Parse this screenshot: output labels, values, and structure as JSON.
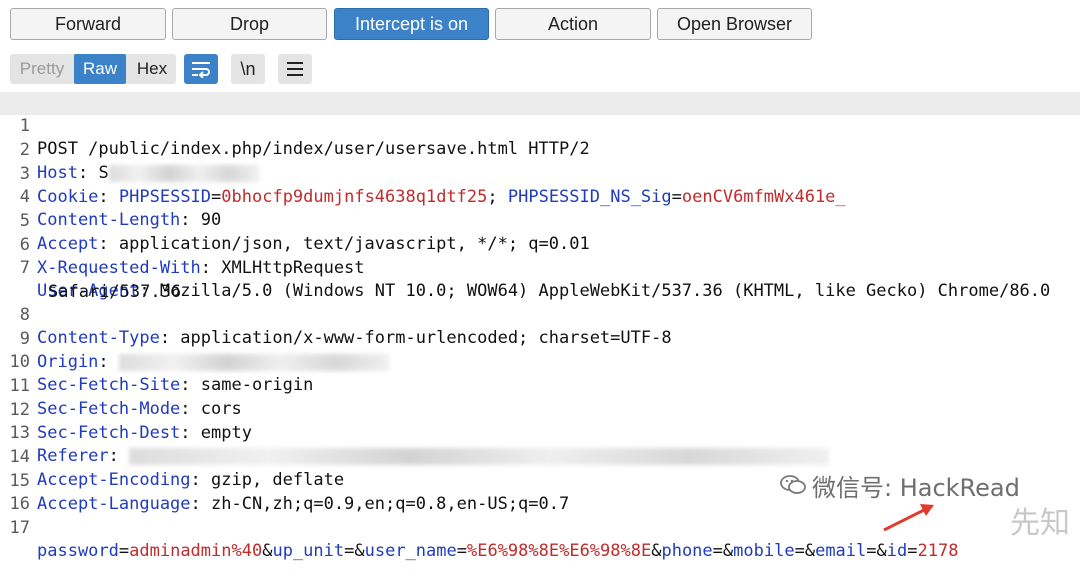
{
  "toolbar": {
    "forward": "Forward",
    "drop": "Drop",
    "intercept": "Intercept is on",
    "action": "Action",
    "open_browser": "Open Browser"
  },
  "view": {
    "pretty": "Pretty",
    "raw": "Raw",
    "hex": "Hex",
    "wrap_icon": "wrap-icon",
    "newline_label": "\\n",
    "menu_icon": "menu-icon"
  },
  "request": {
    "l1": "POST /public/index.php/index/user/usersave.html HTTP/2",
    "host_key": "Host",
    "host_sep": ": ",
    "host_vis": "S",
    "cookie_key": "Cookie",
    "cookie_sep": ": ",
    "cookie_name1": "PHPSESSID",
    "cookie_val1": "0bhocfp9dumjnfs4638q1dtf25",
    "cookie_mid": "; ",
    "cookie_name2": "PHPSESSID_NS_Sig",
    "cookie_val2": "oenCV6mfmWx461e_",
    "cl_key": "Content-Length",
    "cl_val": ": 90",
    "accept_key": "Accept",
    "accept_val": ": application/json, text/javascript, */*; q=0.01",
    "xrw_key": "X-Requested-With",
    "xrw_val": ": XMLHttpRequest",
    "ua_key": "User-Agent",
    "ua_val": ": Mozilla/5.0 (Windows NT 10.0; WOW64) AppleWebKit/537.36 (KHTML, like Gecko) Chrome/86.0",
    "ua_cont": "Safari/537.36",
    "ct_key": "Content-Type",
    "ct_val": ": application/x-www-form-urlencoded; charset=UTF-8",
    "origin_key": "Origin",
    "origin_sep": ":",
    "sfs_key": "Sec-Fetch-Site",
    "sfs_val": ": same-origin",
    "sfm_key": "Sec-Fetch-Mode",
    "sfm_val": ": cors",
    "sfd_key": "Sec-Fetch-Dest",
    "sfd_val": ": empty",
    "referer_key": "Referer",
    "referer_sep": ":",
    "ae_key": "Accept-Encoding",
    "ae_val": ": gzip, deflate",
    "al_key": "Accept-Language",
    "al_val": ": zh-CN,zh;q=0.9,en;q=0.8,en-US;q=0.7",
    "body": {
      "k1": "password",
      "v1": "adminadmin%40",
      "k2": "up_unit",
      "v2": "",
      "k3": "user_name",
      "v3": "%E6%98%8E%E6%98%8E",
      "k4": "phone",
      "v4": "",
      "k5": "mobile",
      "v5": "",
      "k6": "email",
      "v6": "",
      "k7": "id",
      "v7": "2178",
      "eq": "=",
      "amp": "&"
    }
  },
  "line_numbers": [
    "1",
    "2",
    "3",
    "4",
    "5",
    "6",
    "7",
    "8",
    "9",
    "10",
    "11",
    "12",
    "13",
    "14",
    "15",
    "16",
    "17"
  ],
  "watermark": {
    "icon": "wechat-icon",
    "text": "微信号: HackRead",
    "corner": "先知"
  },
  "colors": {
    "accent": "#3c82c9",
    "header_key": "#1f3bbf",
    "value_red": "#c02b2b",
    "arrow": "#e03a2e"
  }
}
